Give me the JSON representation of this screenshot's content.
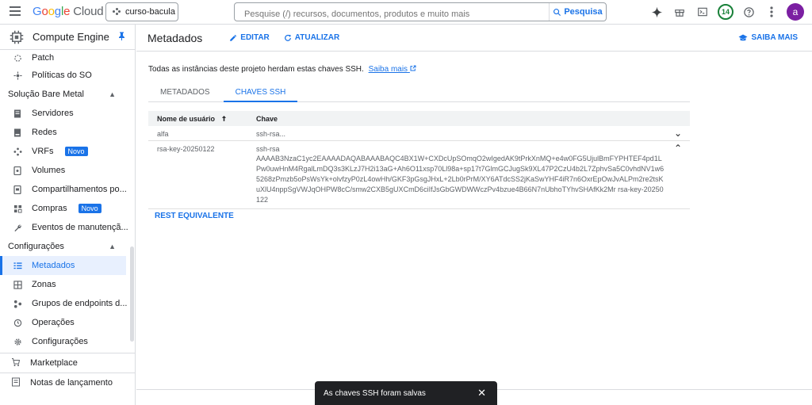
{
  "topbar": {
    "logo_google": "Google",
    "logo_cloud": "Cloud",
    "project": "curso-bacula",
    "search_placeholder": "Pesquise (/) recursos, documentos, produtos e muito mais",
    "search_button": "Pesquisa",
    "notifications_count": "14",
    "avatar_letter": "a"
  },
  "sidebar": {
    "title": "Compute Engine",
    "items": [
      {
        "label": "Patch",
        "icon": "patch-icon"
      },
      {
        "label": "Políticas do SO",
        "icon": "policy-icon"
      }
    ],
    "section_baremetal": "Solução Bare Metal",
    "baremetal_items": [
      {
        "label": "Servidores"
      },
      {
        "label": "Redes"
      },
      {
        "label": "VRFs",
        "badge": "Novo"
      },
      {
        "label": "Volumes"
      },
      {
        "label": "Compartilhamentos po..."
      },
      {
        "label": "Compras",
        "badge": "Novo"
      },
      {
        "label": "Eventos de manutençã..."
      }
    ],
    "section_config": "Configurações",
    "config_items": [
      {
        "label": "Metadados",
        "active": true
      },
      {
        "label": "Zonas"
      },
      {
        "label": "Grupos de endpoints d..."
      },
      {
        "label": "Operações"
      },
      {
        "label": "Configurações"
      }
    ],
    "bottom_items": [
      {
        "label": "Marketplace"
      },
      {
        "label": "Notas de lançamento"
      }
    ]
  },
  "main": {
    "title": "Metadados",
    "edit": "EDITAR",
    "refresh": "ATUALIZAR",
    "learn_more": "SAIBA MAIS",
    "info_text": "Todas as instâncias deste projeto herdam estas chaves SSH.",
    "info_link": "Saiba mais",
    "tabs": [
      "METADADOS",
      "CHAVES SSH"
    ],
    "table": {
      "headers": [
        "Nome de usuário",
        "Chave"
      ],
      "rows": [
        {
          "user": "alfa",
          "key_short": "ssh-rsa...",
          "expanded": false
        },
        {
          "user": "rsa-key-20250122",
          "key_type": "ssh-rsa",
          "key_full": "AAAAB3NzaC1yc2EAAAADAQABAAABAQC4BX1W+CXDcUpSOmqO2wIgedAK9tPrkXnMQ+e4w0FG5UjulBmFYPHTEF4pd1LPw0uwHnM4RgalLmDQ3s3KLzJ7H2i13aG+Ah6O11xsp70Ll98a+sp17t7GlmGCJugSk9XL47P2CzU4b2L7ZphvSa5C0vhdNV1w65268zPmzb5oPsWsYk+olvfzyP0zL4owHh/GKF3pGsgJHxL+2Lb0rPrM/XY6ATdcSS2jKaSwYHF4iR7n6OxrEpOwJvALPm2re2tsKuXlU4nppSgVWJqOHPW8cC/smw2CXB5gUXCmD6ciIfJsGbGWDWWczPv4bzue4B66N7nUbhoTYhvSHAfKk2Mr rsa-key-20250122",
          "expanded": true
        }
      ]
    },
    "rest": "REST EQUIVALENTE"
  },
  "snackbar": {
    "message": "As chaves SSH foram salvas"
  }
}
